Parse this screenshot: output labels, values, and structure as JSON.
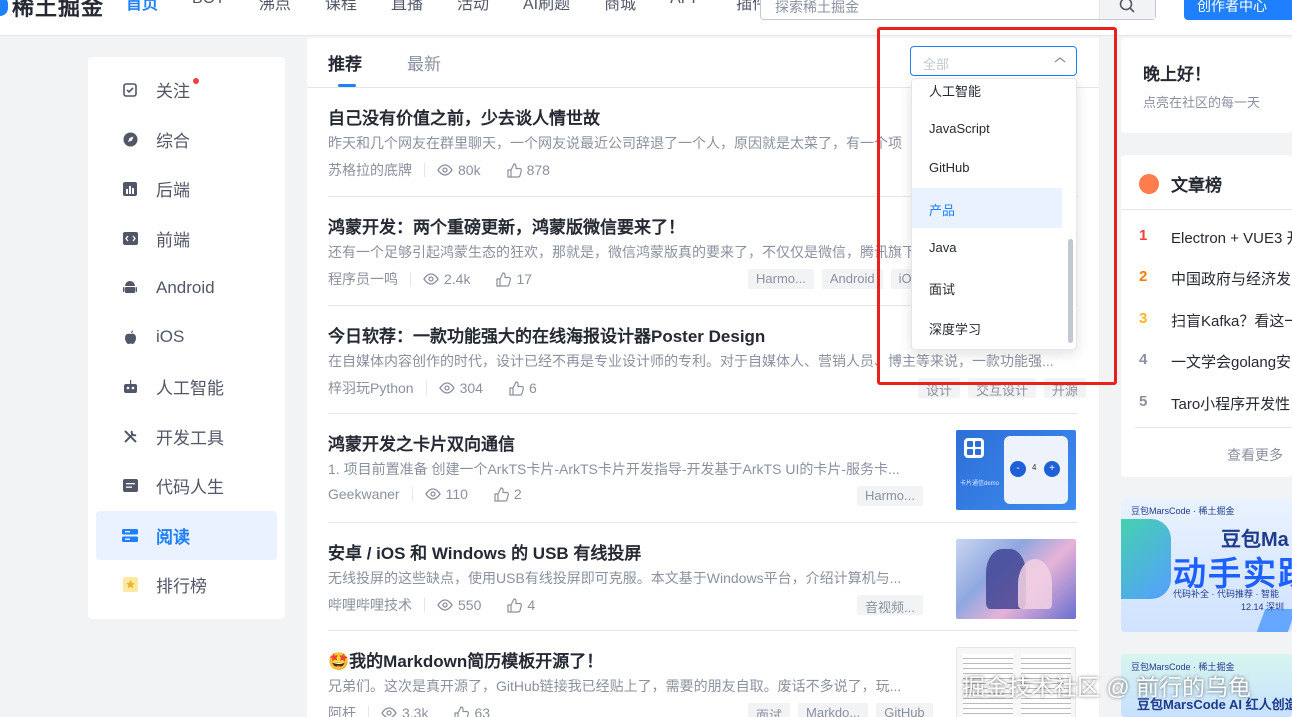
{
  "header": {
    "logo_text": "稀土掘金",
    "nav": [
      "首页",
      "BOT",
      "沸点",
      "课程",
      "直播",
      "活动",
      "AI刷题",
      "商城",
      "APP",
      "插件"
    ],
    "search_placeholder": "探索稀土掘金",
    "creator_button": "创作者中心"
  },
  "sidebar": {
    "items": [
      {
        "label": "关注",
        "icon": "follow-icon"
      },
      {
        "label": "综合",
        "icon": "compass-icon"
      },
      {
        "label": "后端",
        "icon": "chart-icon"
      },
      {
        "label": "前端",
        "icon": "code-icon"
      },
      {
        "label": "Android",
        "icon": "android-icon"
      },
      {
        "label": "iOS",
        "icon": "apple-icon"
      },
      {
        "label": "人工智能",
        "icon": "robot-icon"
      },
      {
        "label": "开发工具",
        "icon": "tools-icon"
      },
      {
        "label": "代码人生",
        "icon": "terminal-icon"
      },
      {
        "label": "阅读",
        "icon": "book-icon"
      },
      {
        "label": "排行榜",
        "icon": "trophy-icon"
      }
    ]
  },
  "feed": {
    "tabs": [
      "推荐",
      "最新"
    ],
    "filter_value": "全部",
    "articles": [
      {
        "title": "自己没有价值之前，少去谈人情世故",
        "abstract": "昨天和几个网友在群里聊天，一个网友说最近公司辞退了一个人，原因就是太菜了，有一个项",
        "author": "苏格拉的底牌",
        "views": "80k",
        "likes": "878",
        "tags": []
      },
      {
        "title": "鸿蒙开发：两个重磅更新，鸿蒙版微信要来了！",
        "abstract": "还有一个足够引起鸿蒙生态的狂欢，那就是，微信鸿蒙版真的要来了，不仅仅是微信，腾讯旗下",
        "author": "程序员一鸣",
        "views": "2.4k",
        "likes": "17",
        "tags": [
          "Harmo...",
          "Android",
          "iOS"
        ]
      },
      {
        "title": "今日软荐：一款功能强大的在线海报设计器Poster Design",
        "abstract": "在自媒体内容创作的时代，设计已经不再是专业设计师的专利。对于自媒体人、营销人员、博主等来说，一款功能强...",
        "author": "梓羽玩Python",
        "views": "304",
        "likes": "6",
        "tags": [
          "设计",
          "交互设计",
          "开源"
        ]
      },
      {
        "title": "鸿蒙开发之卡片双向通信",
        "abstract": "1. 项目前置准备 创建一个ArkTS卡片-ArkTS卡片开发指导-开发基于ArkTS UI的卡片-服务卡...",
        "author": "Geekwaner",
        "views": "110",
        "likes": "2",
        "tags": [
          "Harmo..."
        ]
      },
      {
        "title": "安卓 / iOS 和 Windows 的 USB 有线投屏",
        "abstract": "无线投屏的这些缺点，使用USB有线投屏即可克服。本文基于Windows平台，介绍计算机与...",
        "author": "哔哩哔哩技术",
        "views": "550",
        "likes": "4",
        "tags": [
          "音视频..."
        ]
      },
      {
        "title": "🤩我的Markdown简历模板开源了！",
        "abstract": "兄弟们。这次是真开源了，GitHub链接我已经贴上了，需要的朋友自取。废话不多说了，玩...",
        "author": "阿杆",
        "views": "3.3k",
        "likes": "63",
        "tags": [
          "面试",
          "Markdo...",
          "GitHub"
        ]
      }
    ],
    "card_thumb": {
      "card_label": "卡片通信demo",
      "count": "4",
      "minus": "-",
      "plus": "+"
    }
  },
  "dropdown": {
    "options": [
      "人工智能",
      "JavaScript",
      "GitHub",
      "产品",
      "Java",
      "面试",
      "深度学习"
    ],
    "active": "产品"
  },
  "right": {
    "greeting": "晚上好！",
    "greeting_sub": "点亮在社区的每一天",
    "rank_title": "文章榜",
    "rank_items": [
      {
        "num": "1",
        "title": "Electron + VUE3 开"
      },
      {
        "num": "2",
        "title": "中国政府与经济发"
      },
      {
        "num": "3",
        "title": "扫盲Kafka？看这一"
      },
      {
        "num": "4",
        "title": "一文学会golang安"
      },
      {
        "num": "5",
        "title": "Taro小程序开发性"
      }
    ],
    "more": "查看更多",
    "banner1": {
      "brand": "豆包MarsCode",
      "partner": "稀土掘金",
      "headline1": "豆包Ma",
      "headline2": "动手实践",
      "sub": "代码补全 · 代码推荐 · 智能",
      "date": "12.14 深圳"
    },
    "banner2": {
      "brand": "豆包MarsCode",
      "partner": "稀土掘金",
      "headline": "豆包MarsCode AI 红人创造"
    }
  },
  "watermark": "掘金技术社区 @ 前行的乌龟",
  "colors": {
    "accent": "#1e80ff",
    "highlight_frame": "#e8211c"
  }
}
